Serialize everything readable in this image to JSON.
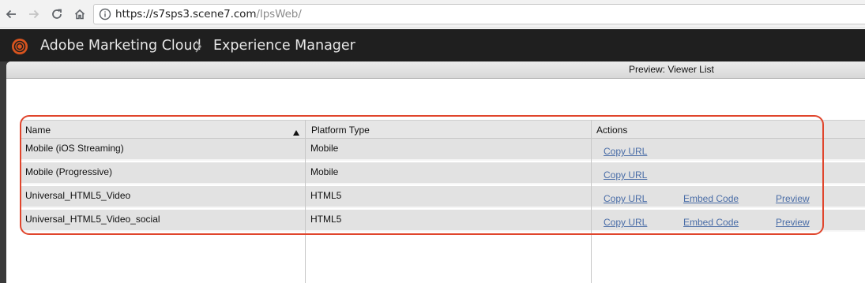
{
  "browser": {
    "url_host": "https://s7sps3.scene7.com",
    "url_path": "/IpsWeb/",
    "icons": [
      "back-arrow-icon",
      "forward-arrow-icon",
      "reload-icon",
      "home-icon",
      "info-icon"
    ]
  },
  "header": {
    "brand": "Adobe Marketing Cloud",
    "section": "Experience Manager",
    "logo_icon": "adobe-marketing-cloud-logo-icon"
  },
  "dialog": {
    "title": "Preview: Viewer List"
  },
  "table": {
    "columns": [
      {
        "label": "Name",
        "sorted": "ascending"
      },
      {
        "label": "Platform Type"
      },
      {
        "label": "Actions"
      }
    ],
    "rows": [
      {
        "name": "Mobile (iOS Streaming)",
        "platform": "Mobile",
        "actions": [
          "Copy URL"
        ]
      },
      {
        "name": "Mobile (Progressive)",
        "platform": "Mobile",
        "actions": [
          "Copy URL"
        ]
      },
      {
        "name": "Universal_HTML5_Video",
        "platform": "HTML5",
        "actions": [
          "Copy URL",
          "Embed Code",
          "Preview"
        ]
      },
      {
        "name": "Universal_HTML5_Video_social",
        "platform": "HTML5",
        "actions": [
          "Copy URL",
          "Embed Code",
          "Preview"
        ]
      }
    ]
  },
  "colors": {
    "link": "#4a6da7",
    "highlight": "#e0452c",
    "header_bg": "#1f1f1f"
  }
}
